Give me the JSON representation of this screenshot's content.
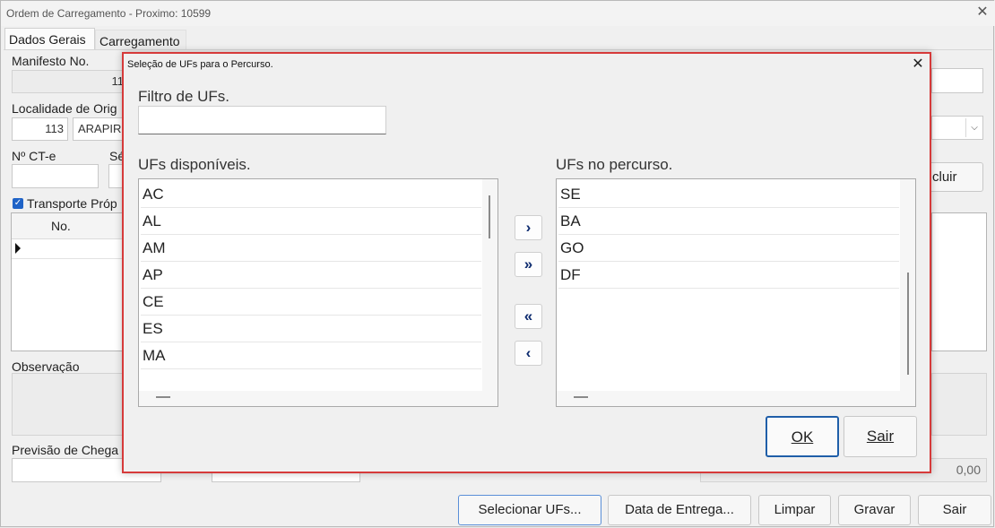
{
  "window": {
    "title": "Ordem de Carregamento - Proximo: 10599"
  },
  "tabs": [
    "Dados Gerais",
    "Carregamento"
  ],
  "form": {
    "manifesto_label": "Manifesto No.",
    "manifesto_value": "11",
    "localidade_label": "Localidade de Orig",
    "localidade_code": "113",
    "localidade_name": "ARAPIR",
    "ct_label": "Nº CT-e",
    "serie_label": "Sé",
    "transporte_label": "Transporte Próp",
    "grid_header": "No.",
    "observacao_label": "Observação",
    "previsao_label": "Previsão de Chega",
    "total_value": "0,00",
    "incluir_label": "cluir"
  },
  "dialog": {
    "title": "Seleção de UFs para o Percurso.",
    "filter_label": "Filtro de UFs.",
    "filter_value": "",
    "available_label": "UFs disponíveis.",
    "route_label": "UFs no percurso.",
    "available": [
      "AC",
      "AL",
      "AM",
      "AP",
      "CE",
      "ES",
      "MA"
    ],
    "route": [
      "SE",
      "BA",
      "GO",
      "DF"
    ],
    "ok_label": "OK",
    "sair_label": "Sair"
  },
  "bottom_buttons": [
    "Selecionar UFs...",
    "Data de Entrega...",
    "Limpar",
    "Gravar",
    "Sair"
  ]
}
